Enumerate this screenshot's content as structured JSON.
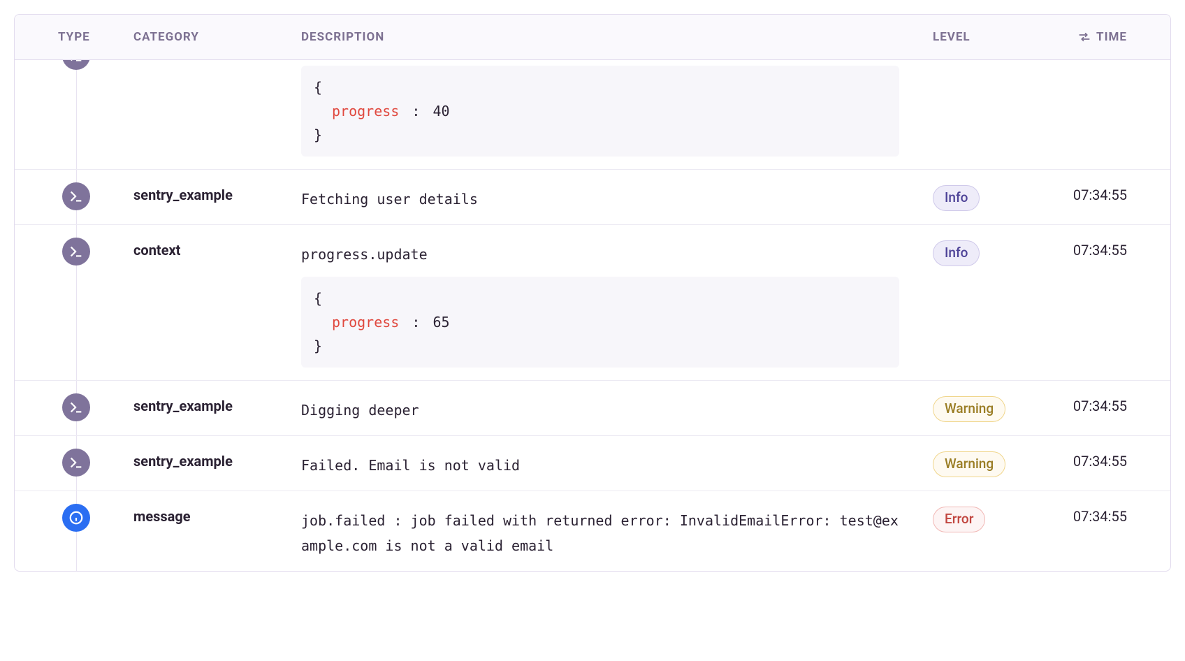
{
  "columns": {
    "type": "TYPE",
    "category": "CATEGORY",
    "description": "DESCRIPTION",
    "level": "LEVEL",
    "time": "TIME"
  },
  "level_labels": {
    "info": "Info",
    "warning": "Warning",
    "error": "Error"
  },
  "rows": [
    {
      "icon": "terminal",
      "category": "",
      "description": "",
      "code": {
        "key": "progress",
        "value": "40"
      },
      "level": "",
      "time": ""
    },
    {
      "icon": "terminal",
      "category": "sentry_example",
      "description": "Fetching user details",
      "level": "info",
      "time": "07:34:55"
    },
    {
      "icon": "terminal",
      "category": "context",
      "description": "progress.update",
      "code": {
        "key": "progress",
        "value": "65"
      },
      "level": "info",
      "time": "07:34:55"
    },
    {
      "icon": "terminal",
      "category": "sentry_example",
      "description": "Digging deeper",
      "level": "warning",
      "time": "07:34:55"
    },
    {
      "icon": "terminal",
      "category": "sentry_example",
      "description": "Failed. Email is not valid",
      "level": "warning",
      "time": "07:34:55"
    },
    {
      "icon": "info",
      "category": "message",
      "description": "job.failed : job failed with returned error: InvalidEmailError: test@example.com is not a valid email",
      "level": "error",
      "time": "07:34:55"
    }
  ]
}
